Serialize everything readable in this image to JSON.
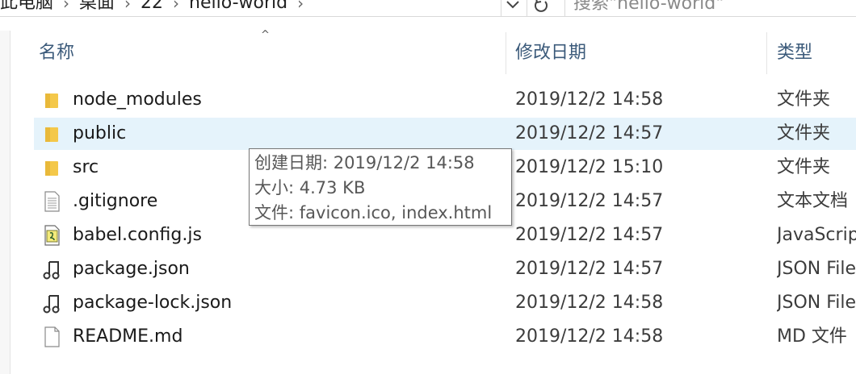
{
  "address": {
    "segments": [
      "此电脑",
      "桌面",
      "22",
      "hello-world"
    ],
    "separator": "›",
    "dropdown_icon": "chevron-down-icon",
    "refresh_icon": "refresh-icon"
  },
  "search": {
    "placeholder": "搜索\"hello-world\""
  },
  "columns": {
    "name": "名称",
    "date": "修改日期",
    "type": "类型",
    "sort_indicator": "^"
  },
  "files": [
    {
      "name": "node_modules",
      "date": "2019/12/2 14:58",
      "type": "文件夹",
      "icon": "folder-icon"
    },
    {
      "name": "public",
      "date": "2019/12/2 14:57",
      "type": "文件夹",
      "icon": "folder-icon",
      "selected": true
    },
    {
      "name": "src",
      "date": "2019/12/2 15:10",
      "type": "文件夹",
      "icon": "folder-icon"
    },
    {
      "name": ".gitignore",
      "date": "2019/12/2 14:57",
      "type": "文本文档",
      "icon": "text-file-icon"
    },
    {
      "name": "babel.config.js",
      "date": "2019/12/2 14:57",
      "type": "JavaScript",
      "icon": "js-file-icon"
    },
    {
      "name": "package.json",
      "date": "2019/12/2 14:57",
      "type": "JSON File",
      "icon": "json-file-icon"
    },
    {
      "name": "package-lock.json",
      "date": "2019/12/2 14:58",
      "type": "JSON File",
      "icon": "json-file-icon"
    },
    {
      "name": "README.md",
      "date": "2019/12/2 14:58",
      "type": "MD 文件",
      "icon": "blank-file-icon"
    }
  ],
  "tooltip": {
    "created": "创建日期: 2019/12/2 14:58",
    "size": "大小: 4.73 KB",
    "files": "文件: favicon.ico, index.html"
  },
  "colors": {
    "selection": "#e5f3fb",
    "folder": "#f4c84a",
    "header_text": "#3b5a7a"
  }
}
